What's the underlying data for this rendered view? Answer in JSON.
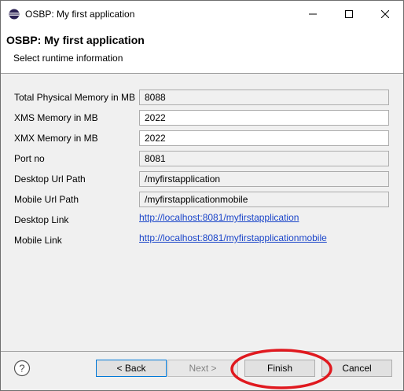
{
  "window": {
    "title": "OSBP: My first application"
  },
  "header": {
    "title": "OSBP: My first application",
    "subtitle": "Select runtime information"
  },
  "form": {
    "total_memory": {
      "label": "Total Physical Memory in MB",
      "value": "8088"
    },
    "xms_memory": {
      "label": "XMS Memory in MB",
      "value": "2022"
    },
    "xmx_memory": {
      "label": "XMX Memory in MB",
      "value": "2022"
    },
    "port": {
      "label": "Port no",
      "value": "8081"
    },
    "desktop_url_path": {
      "label": "Desktop Url Path",
      "value": "/myfirstapplication"
    },
    "mobile_url_path": {
      "label": "Mobile Url Path",
      "value": "/myfirstapplicationmobile"
    },
    "desktop_link": {
      "label": "Desktop Link",
      "value": "http://localhost:8081/myfirstapplication"
    },
    "mobile_link": {
      "label": "Mobile Link",
      "value": "http://localhost:8081/myfirstapplicationmobile"
    }
  },
  "buttons": {
    "back": "< Back",
    "next": "Next >",
    "finish": "Finish",
    "cancel": "Cancel"
  },
  "icons": {
    "app": "eclipse-icon",
    "help": "help-icon",
    "minimize": "minimize-icon",
    "maximize": "maximize-icon",
    "close": "close-icon"
  },
  "colors": {
    "link": "#1a45c9",
    "annotation": "#e0191f",
    "focus_border": "#0078d7"
  }
}
